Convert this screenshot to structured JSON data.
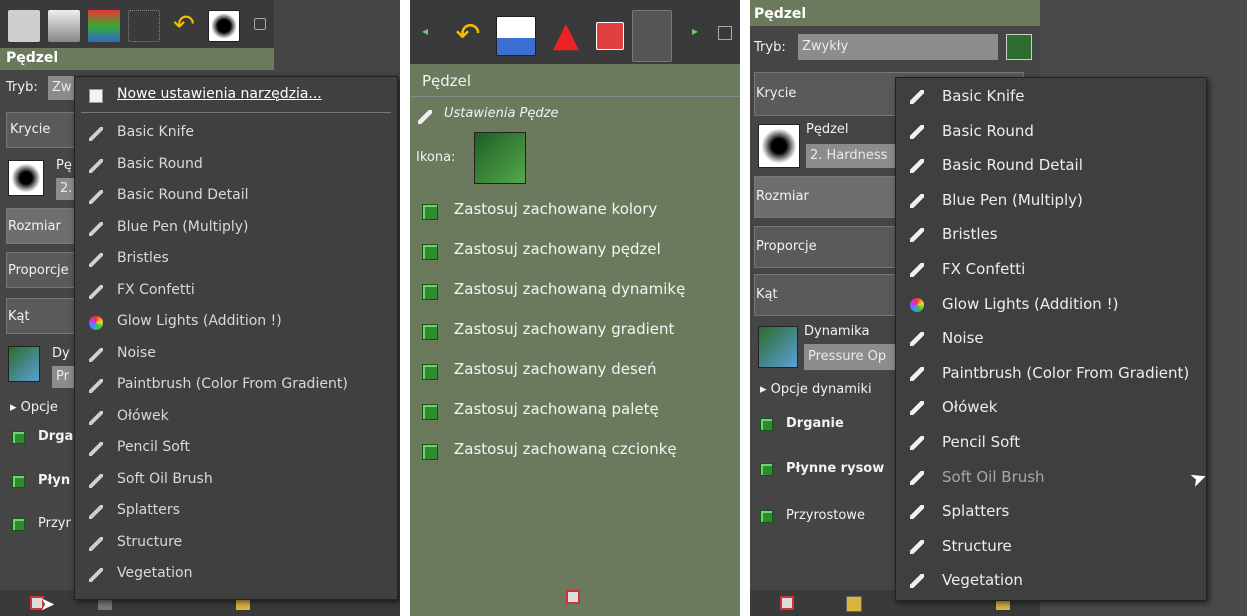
{
  "left": {
    "header": "Pędzel",
    "mode_label": "Tryb:",
    "mode_value": "Zw",
    "opacity_label": "Krycie",
    "brush_short1": "Pę",
    "brush_short2": "2.",
    "size_label": "Rozmiar",
    "aspect_label": "Proporcje",
    "angle_label": "Kąt",
    "dyn_short1": "Dy",
    "dyn_short2": "Pr",
    "options_short": "Opcje",
    "jitter_short": "Drga",
    "smooth_short": "Płyn",
    "incr_short": "Przyr",
    "menu_new": "Nowe ustawienia narzędzia...",
    "menu_items": [
      "Basic Knife",
      "Basic Round",
      "Basic Round Detail",
      "Blue Pen (Multiply)",
      "Bristles",
      "FX Confetti",
      "Glow Lights (Addition !)",
      "Noise",
      "Paintbrush (Color From Gradient)",
      "Ołówek",
      "Pencil Soft",
      "Soft Oil Brush",
      "Splatters",
      "Structure",
      "Vegetation"
    ]
  },
  "middle": {
    "header": "Pędzel",
    "settings_label": "Ustawienia Pędze",
    "icon_label": "Ikona:",
    "options": [
      "Zastosuj zachowane kolory",
      "Zastosuj zachowany pędzel",
      "Zastosuj zachowaną dynamikę",
      "Zastosuj zachowany gradient",
      "Zastosuj zachowany deseń",
      "Zastosuj zachowaną paletę",
      "Zastosuj zachowaną czcionkę"
    ]
  },
  "right": {
    "header": "Pędzel",
    "mode_label": "Tryb:",
    "mode_value": "Zwykły",
    "opacity_label": "Krycie",
    "brush_label": "Pędzel",
    "brush_value": "2. Hardness",
    "size_label": "Rozmiar",
    "aspect_label": "Proporcje",
    "angle_label": "Kąt",
    "dyn_label": "Dynamika",
    "dyn_value": "Pressure Op",
    "options_label": "Opcje dynamiki",
    "jitter_label": "Drganie",
    "smooth_label": "Płynne rysow",
    "incr_label": "Przyrostowe",
    "menu_items": [
      "Basic Knife",
      "Basic Round",
      "Basic Round Detail",
      "Blue Pen (Multiply)",
      "Bristles",
      "FX Confetti",
      "Glow Lights (Addition !)",
      "Noise",
      "Paintbrush (Color From Gradient)",
      "Ołówek",
      "Pencil Soft",
      "Soft Oil Brush",
      "Splatters",
      "Structure",
      "Vegetation"
    ]
  }
}
